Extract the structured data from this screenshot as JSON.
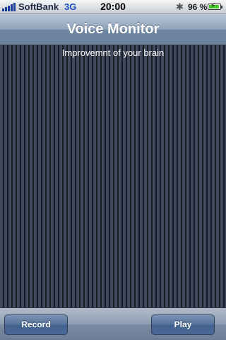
{
  "status_bar": {
    "carrier": "SoftBank",
    "network": "3G",
    "time": "20:00",
    "bluetooth_icon": "bluetooth-icon",
    "battery_percent": "96 %",
    "battery_level": 0.96,
    "charging_icon": "lightning-bolt-icon"
  },
  "nav_bar": {
    "title": "Voice Monitor"
  },
  "content": {
    "subtitle": "Improvemnt of your brain"
  },
  "toolbar": {
    "record_label": "Record",
    "play_label": "Play"
  },
  "colors": {
    "nav_bar": "#8fa2ba",
    "content_background": "#3d4454",
    "stripe_dark": "#161a22",
    "button": "#4a6996",
    "battery_fill": "#46c92f"
  }
}
